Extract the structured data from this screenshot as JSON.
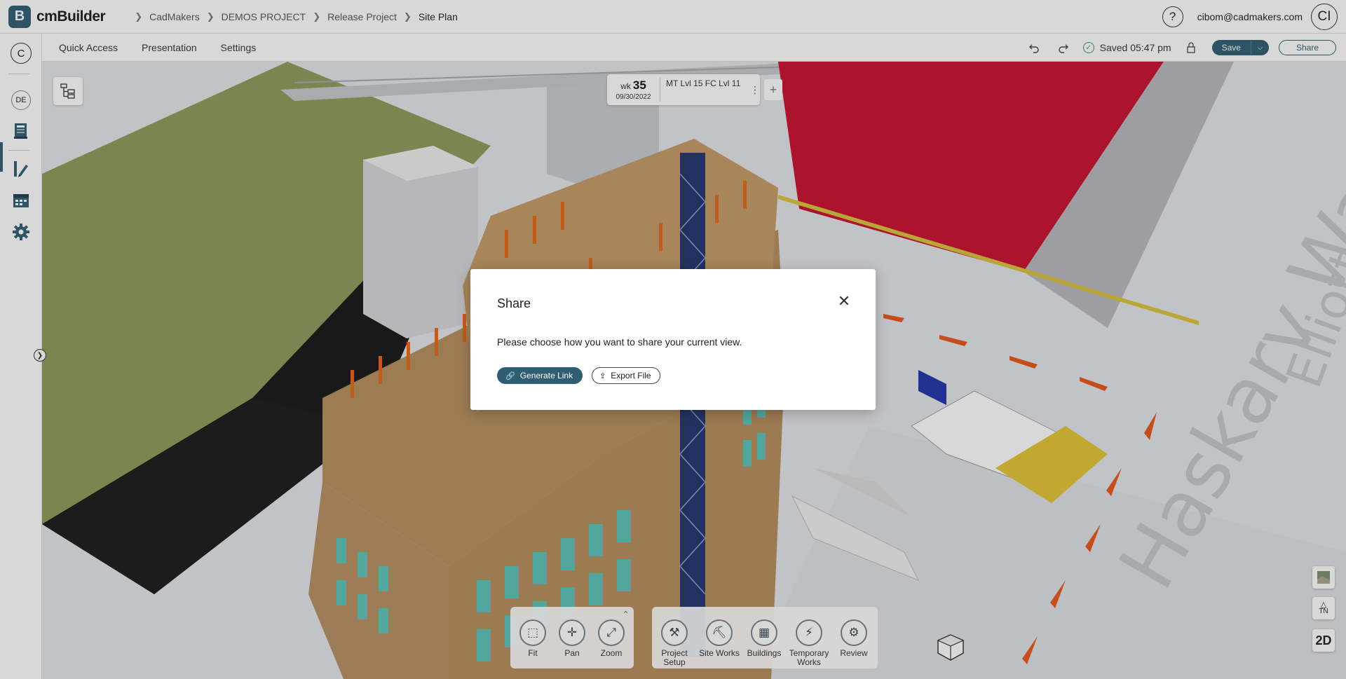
{
  "header": {
    "logo_letter": "B",
    "app_name": "cmBuilder",
    "breadcrumb": [
      "CadMakers",
      "DEMOS PROJECT",
      "Release Project",
      "Site Plan"
    ],
    "help_icon": "?",
    "user_email": "cibom@cadmakers.com",
    "avatar_initials": "CI"
  },
  "sidebar": {
    "company_initial": "C",
    "workspace_initials": "DE",
    "items": [
      {
        "icon": "model-icon"
      },
      {
        "icon": "site-plan-pencil-icon",
        "active": true
      },
      {
        "icon": "schedule-icon"
      },
      {
        "icon": "gear-icon"
      }
    ]
  },
  "toolbar": {
    "menu": [
      "Quick Access",
      "Presentation",
      "Settings"
    ],
    "saved_status": "Saved 05:47 pm",
    "save_label": "Save",
    "share_label": "Share"
  },
  "timeline": {
    "week_prefix": "wk",
    "week_number": "35",
    "date": "09/30/2022",
    "task": "MT Lvl 15 FC Lvl 11"
  },
  "nav_tools": [
    {
      "label": "Fit",
      "icon": "fit-icon"
    },
    {
      "label": "Pan",
      "icon": "pan-icon"
    },
    {
      "label": "Zoom",
      "icon": "zoom-icon"
    }
  ],
  "work_tools": [
    {
      "label": "Project Setup",
      "icon": "tools-icon"
    },
    {
      "label": "Site Works",
      "icon": "excavator-icon"
    },
    {
      "label": "Buildings",
      "icon": "building-icon"
    },
    {
      "label": "Temporary Works",
      "icon": "crane-icon"
    },
    {
      "label": "Review",
      "icon": "review-icon"
    }
  ],
  "right_controls": {
    "north_label": "TN",
    "view_2d": "2D"
  },
  "scene": {
    "street_name": "Haskarv Way",
    "street_name_2": "Elliott"
  },
  "modal": {
    "title": "Share",
    "message": "Please choose how you want to share your current view.",
    "generate_link": "Generate Link",
    "export_file": "Export File"
  }
}
